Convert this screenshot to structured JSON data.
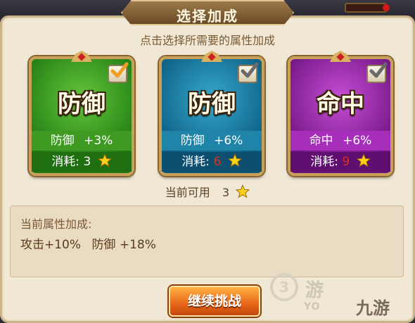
{
  "title": "选择加成",
  "subtitle": "点击选择所需要的属性加成",
  "cards": [
    {
      "name": "防御",
      "stat_label": "防御",
      "stat_value": "+3%",
      "cost_label": "消耗:",
      "cost": "3",
      "affordable": true,
      "checked": true,
      "color": "#2f9a1c"
    },
    {
      "name": "防御",
      "stat_label": "防御",
      "stat_value": "+6%",
      "cost_label": "消耗:",
      "cost": "6",
      "affordable": false,
      "checked": true,
      "color": "#1a7fa6"
    },
    {
      "name": "命中",
      "stat_label": "命中",
      "stat_value": "+6%",
      "cost_label": "消耗:",
      "cost": "9",
      "affordable": false,
      "checked": true,
      "color": "#9a25b0"
    }
  ],
  "available": {
    "label": "当前可用",
    "count": "3"
  },
  "current_bonus": {
    "label": "当前属性加成:",
    "items": [
      {
        "text": "攻击+10%"
      },
      {
        "text": "防御 +18%"
      }
    ]
  },
  "continue_button": "继续挑战",
  "watermarks": {
    "w1": "3",
    "w2": "游",
    "w3": "YO",
    "w4": "九游"
  },
  "colors": {
    "accent": "#e7661a",
    "cost_insufficient": "#e0301a",
    "panel": "#f0e7d4"
  }
}
